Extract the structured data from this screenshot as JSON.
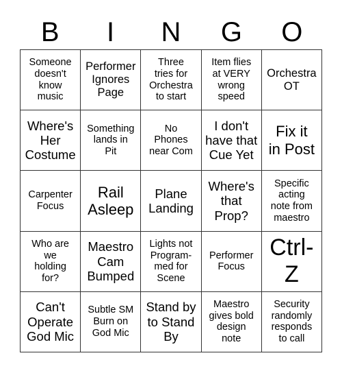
{
  "header": {
    "letters": [
      "B",
      "I",
      "N",
      "G",
      "O"
    ]
  },
  "grid": {
    "rows": [
      [
        {
          "text": "Someone\ndoesn't\nknow\nmusic",
          "size": "s14"
        },
        {
          "text": "Performer\nIgnores\nPage",
          "size": "s16"
        },
        {
          "text": "Three\ntries for\nOrchestra\nto start",
          "size": "s14"
        },
        {
          "text": "Item flies\nat VERY\nwrong\nspeed",
          "size": "s14"
        },
        {
          "text": "Orchestra\nOT",
          "size": "s16"
        }
      ],
      [
        {
          "text": "Where's\nHer\nCostume",
          "size": "s18"
        },
        {
          "text": "Something\nlands in\nPit",
          "size": "s14"
        },
        {
          "text": "No\nPhones\nnear Com",
          "size": "s14"
        },
        {
          "text": "I don't\nhave that\nCue Yet",
          "size": "s18"
        },
        {
          "text": "Fix it\nin Post",
          "size": "s22"
        }
      ],
      [
        {
          "text": "Carpenter\nFocus",
          "size": "s14"
        },
        {
          "text": "Rail\nAsleep",
          "size": "s22"
        },
        {
          "text": "Plane\nLanding",
          "size": "s18"
        },
        {
          "text": "Where's\nthat\nProp?",
          "size": "s18"
        },
        {
          "text": "Specific\nacting\nnote from\nmaestro",
          "size": "s14"
        }
      ],
      [
        {
          "text": "Who are\nwe\nholding\nfor?",
          "size": "s14"
        },
        {
          "text": "Maestro\nCam\nBumped",
          "size": "s18"
        },
        {
          "text": "Lights not\nProgram-\nmed for\nScene",
          "size": "s14"
        },
        {
          "text": "Performer\nFocus",
          "size": "s14"
        },
        {
          "text": "Ctrl-\nZ",
          "size": "s34"
        }
      ],
      [
        {
          "text": "Can't\nOperate\nGod Mic",
          "size": "s18"
        },
        {
          "text": "Subtle SM\nBurn on\nGod Mic",
          "size": "s14"
        },
        {
          "text": "Stand by\nto Stand\nBy",
          "size": "s18"
        },
        {
          "text": "Maestro\ngives bold\ndesign\nnote",
          "size": "s14"
        },
        {
          "text": "Security\nrandomly\nresponds\nto call",
          "size": "s14"
        }
      ]
    ]
  }
}
